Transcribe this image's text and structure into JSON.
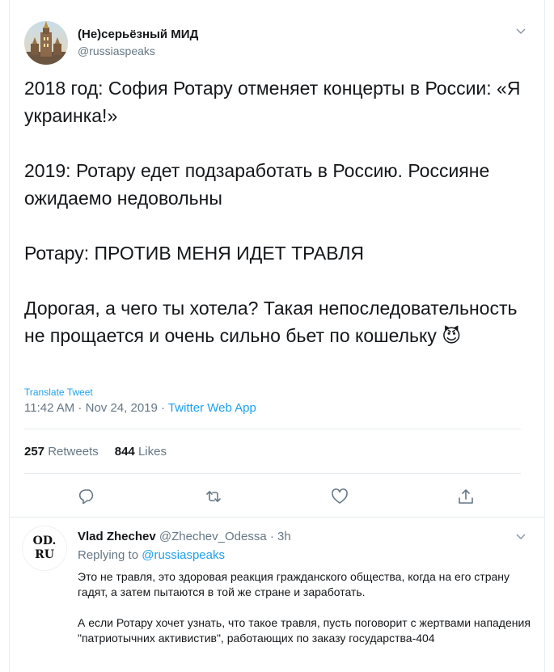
{
  "tweet": {
    "author_name": "(Не)серьёзный МИД",
    "author_handle": "@russiaspeaks",
    "paragraphs": [
      "2018 год: София Ротару отменяет концерты в России: «Я украинка!»",
      "2019: Ротару едет подзаработать в Россию. Россияне ожидаемо недовольны",
      "Ротару: ПРОТИВ МЕНЯ ИДЕТ ТРАВЛЯ",
      "Дорогая, а чего ты хотела? Такая непоследовательность не прощается и очень сильно бьет по кошельку"
    ],
    "emoji": "😈",
    "translate_label": "Translate Tweet",
    "time": "11:42 AM",
    "date": "Nov 24, 2019",
    "source": "Twitter Web App",
    "retweets_count": "257",
    "retweets_label": "Retweets",
    "likes_count": "844",
    "likes_label": "Likes"
  },
  "actions": [
    {
      "icon": "reply-icon"
    },
    {
      "icon": "retweet-icon"
    },
    {
      "icon": "like-icon"
    },
    {
      "icon": "share-icon"
    }
  ],
  "reply": {
    "avatar_line1": "OD.",
    "avatar_line2": "RU",
    "author_name": "Vlad Zhechev",
    "author_handle": "@Zhechev_Odessa",
    "time": "3h",
    "replying_prefix": "Replying to",
    "replying_to": "@russiaspeaks",
    "paragraphs": [
      "Это не травля, это здоровая реакция гражданского общества, когда на его страну гадят, а затем пытаются в той же стране и заработать.",
      "А если Ротару хочет узнать, что такое травля, пусть поговорит с жертвами нападения \"патриотычних активистив\", работающих по заказу государства-404"
    ]
  },
  "colors": {
    "link": "#1da1f2",
    "secondary": "#657786",
    "text": "#14171a",
    "border": "#e6ecf0"
  }
}
